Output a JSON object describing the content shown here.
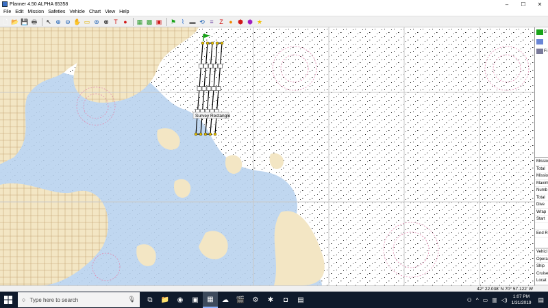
{
  "window": {
    "title": "Planner 4.50 ALPHA 65358",
    "minimize": "–",
    "maximize": "☐",
    "close": "✕"
  },
  "menu": [
    "File",
    "Edit",
    "Mission",
    "Safeties",
    "Vehicle",
    "Chart",
    "View",
    "Help"
  ],
  "toolbar": {
    "tools": [
      {
        "name": "new-icon",
        "glyph": "🗋",
        "color": "#ffffff"
      },
      {
        "name": "open-icon",
        "glyph": "📂",
        "color": "#e6b84a"
      },
      {
        "name": "save-icon",
        "glyph": "💾",
        "color": "#333333"
      },
      {
        "name": "print-icon",
        "glyph": "🖶",
        "color": "#555555"
      },
      {
        "sep": true
      },
      {
        "name": "select-arrow-icon",
        "glyph": "↖",
        "color": "#000000"
      },
      {
        "name": "zoom-in-icon",
        "glyph": "⊕",
        "color": "#1a5fb4"
      },
      {
        "name": "zoom-out-icon",
        "glyph": "⊖",
        "color": "#1a5fb4"
      },
      {
        "name": "pan-hand-icon",
        "glyph": "✋",
        "color": "#8a6a3a"
      },
      {
        "name": "measure-ruler-icon",
        "glyph": "▭",
        "color": "#e0b000"
      },
      {
        "name": "zoom-extents-icon",
        "glyph": "⊚",
        "color": "#1a5fb4"
      },
      {
        "name": "crosshair-icon",
        "glyph": "⊗",
        "color": "#000000"
      },
      {
        "name": "text-tool-icon",
        "glyph": "T",
        "color": "#d01818"
      },
      {
        "name": "waypoint-pin-icon",
        "glyph": "●",
        "color": "#d01818"
      },
      {
        "sep": true
      },
      {
        "name": "survey-pattern-icon",
        "glyph": "▦",
        "color": "#2a9a2a"
      },
      {
        "name": "survey-pattern-alt-icon",
        "glyph": "▩",
        "color": "#2a9a2a"
      },
      {
        "name": "survey-pattern-delete-icon",
        "glyph": "▣",
        "color": "#d01818"
      },
      {
        "sep": true
      },
      {
        "name": "green-flag-icon",
        "glyph": "⚑",
        "color": "#19a319"
      },
      {
        "name": "hydrophone-icon",
        "glyph": "⌇",
        "color": "#2a6fd0"
      },
      {
        "name": "vehicle-icon",
        "glyph": "▬",
        "color": "#666666"
      },
      {
        "name": "loiter-icon",
        "glyph": "⟲",
        "color": "#1a5fb4"
      },
      {
        "name": "lines-icon",
        "glyph": "≡",
        "color": "#6a3fa0"
      },
      {
        "name": "zigzag-icon",
        "glyph": "Z",
        "color": "#d01818"
      },
      {
        "name": "orange-circle-icon",
        "glyph": "●",
        "color": "#f08a00"
      },
      {
        "name": "safety-stop-icon",
        "glyph": "⬢",
        "color": "#d01818"
      },
      {
        "name": "purple-hex-icon",
        "glyph": "⬢",
        "color": "#a020c0"
      },
      {
        "name": "star-icon",
        "glyph": "★",
        "color": "#f0c000"
      }
    ]
  },
  "map": {
    "survey_label": "Survey Rectangle",
    "land_color": "#f3e6c4",
    "shallow_water_color": "#b9d3ee",
    "deep_water_color": "#ffffff",
    "route_color": "#000000",
    "waypoint_color": "#e8c200",
    "flag_color": "#19a319"
  },
  "side_panel": {
    "tree_items": [
      {
        "label": "S",
        "icon": "green-flag-icon"
      },
      {
        "label": "",
        "icon": "vehicle-icon"
      },
      {
        "label": "Fi",
        "icon": "pattern-icon"
      }
    ],
    "properties": [
      "Missio",
      "Total",
      "Missio",
      "Maxim",
      "Numb",
      "Total",
      "Dive",
      "Wrap",
      "Start",
      "",
      "End R"
    ],
    "vehicle_props": [
      "Vehicl",
      "Opera",
      "Ship",
      "Cruise",
      "Locat"
    ]
  },
  "status": {
    "coords": "42° 22.038' N 70° 57.122' W"
  },
  "taskbar": {
    "search_placeholder": "Type here to search",
    "apps": [
      {
        "name": "task-view-icon",
        "glyph": "⧉",
        "active": false
      },
      {
        "name": "file-explorer-icon",
        "glyph": "📁",
        "active": false
      },
      {
        "name": "app-circle-icon",
        "glyph": "◉",
        "active": false
      },
      {
        "name": "app-dark-icon",
        "glyph": "▣",
        "active": false
      },
      {
        "name": "planner-app-icon",
        "glyph": "▦",
        "active": true
      },
      {
        "name": "app-cloud-icon",
        "glyph": "☁",
        "active": false
      },
      {
        "name": "app-clapper-icon",
        "glyph": "🎬",
        "active": false
      },
      {
        "name": "settings-icon",
        "glyph": "⚙",
        "active": false
      },
      {
        "name": "app-red-icon",
        "glyph": "✱",
        "active": false
      },
      {
        "name": "app-gray-icon",
        "glyph": "◘",
        "active": false
      },
      {
        "name": "app-blue-icon",
        "glyph": "▤",
        "active": false
      }
    ],
    "time": "1:07 PM",
    "date": "1/31/2019"
  }
}
